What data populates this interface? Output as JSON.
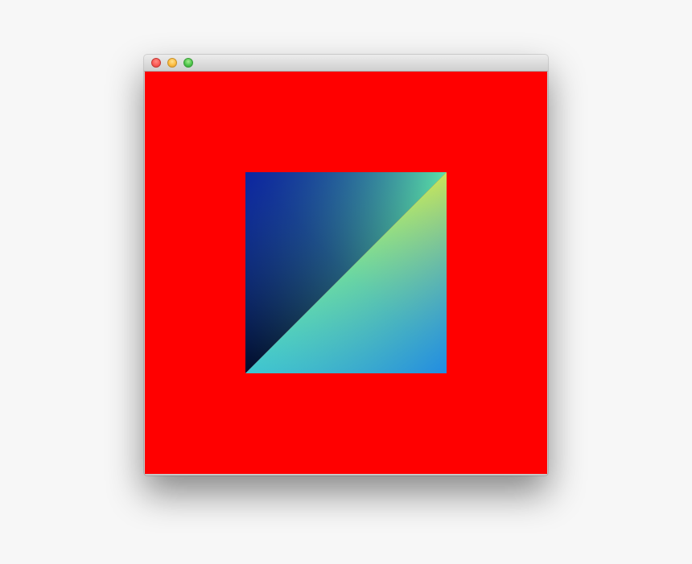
{
  "window": {
    "title": "",
    "buttons": [
      "close",
      "minimize",
      "zoom"
    ]
  },
  "canvas": {
    "clear_color": "#ff0000",
    "quad": {
      "corner_colors": {
        "top_left": "#0a1fa6",
        "top_right": "#5be0aa",
        "bottom_left": "#000a2a",
        "bottom_right": "#1e88e5",
        "diagonal_top": "#c9e35a",
        "diagonal_bottom": "#3ec6d2"
      }
    }
  }
}
